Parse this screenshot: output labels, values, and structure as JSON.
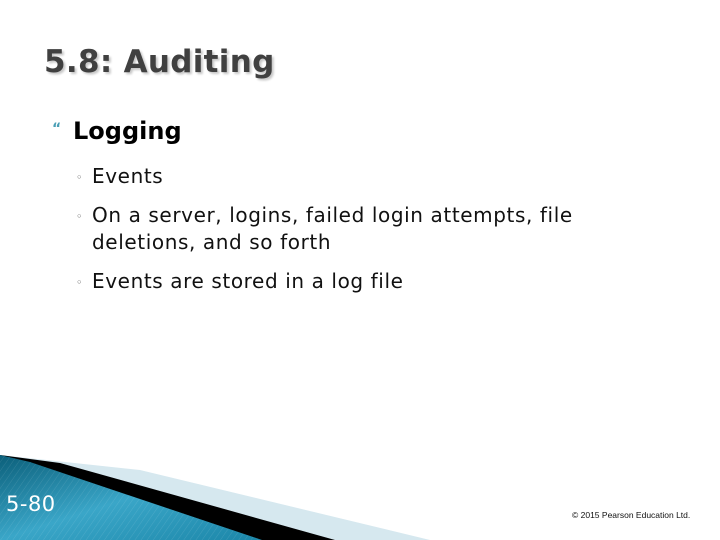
{
  "slide": {
    "title": "5.8: Auditing",
    "bullets": [
      {
        "icon": "quote-bullet-icon",
        "text": "Logging",
        "subitems": [
          {
            "icon": "circle-bullet-icon",
            "text": "Events"
          },
          {
            "icon": "circle-bullet-icon",
            "text": "On a server, logins, failed login attempts, file deletions, and so forth"
          },
          {
            "icon": "circle-bullet-icon",
            "text": "Events are stored in a log file"
          }
        ]
      }
    ],
    "page_number": "5-80",
    "copyright": "© 2015 Pearson Education Ltd.",
    "glyphs": {
      "quote_bullet": "“",
      "circle_bullet": "◦"
    },
    "colors": {
      "accent": "#4a9fb5",
      "footer_teal_dark": "#0e6d8a",
      "footer_teal_light": "#5cbad6",
      "footer_stripe_dark": "#000000",
      "footer_stripe_light": "#d6e8ef"
    }
  }
}
